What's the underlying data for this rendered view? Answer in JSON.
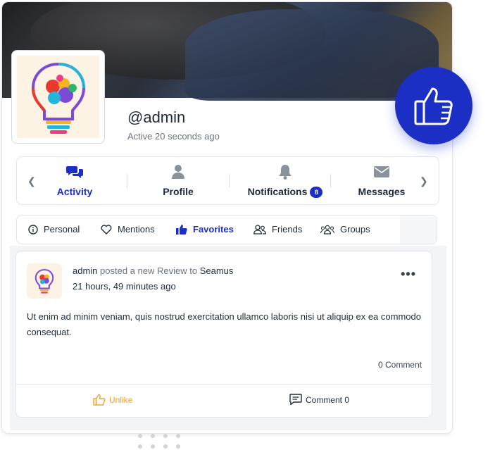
{
  "profile": {
    "username": "@admin",
    "active": "Active 20 seconds ago"
  },
  "nav": {
    "tabs": [
      {
        "label": "Activity",
        "icon": "chat-bubbles-icon"
      },
      {
        "label": "Profile",
        "icon": "user-icon"
      },
      {
        "label": "Notifications",
        "icon": "bell-icon",
        "badge": "8"
      },
      {
        "label": "Messages",
        "icon": "envelope-icon"
      }
    ]
  },
  "subnav": {
    "items": [
      {
        "label": "Personal",
        "icon": "info-icon"
      },
      {
        "label": "Mentions",
        "icon": "heart-icon"
      },
      {
        "label": "Favorites",
        "icon": "thumbs-up-icon"
      },
      {
        "label": "Friends",
        "icon": "friends-icon"
      },
      {
        "label": "Groups",
        "icon": "groups-icon"
      }
    ]
  },
  "post": {
    "author": "admin",
    "action": "posted a new Review to",
    "target": "Seamus",
    "time": "21 hours, 49 minutes ago",
    "body": "Ut enim ad minim veniam, quis nostrud exercitation ullamco laboris nisi ut aliquip ex ea commodo consequat.",
    "comment_count": "0 Comment",
    "unlike_label": "Unlike",
    "comment_label": "Comment 0"
  },
  "colors": {
    "accent": "#1c2fc4",
    "unlike": "#f0a22a"
  }
}
